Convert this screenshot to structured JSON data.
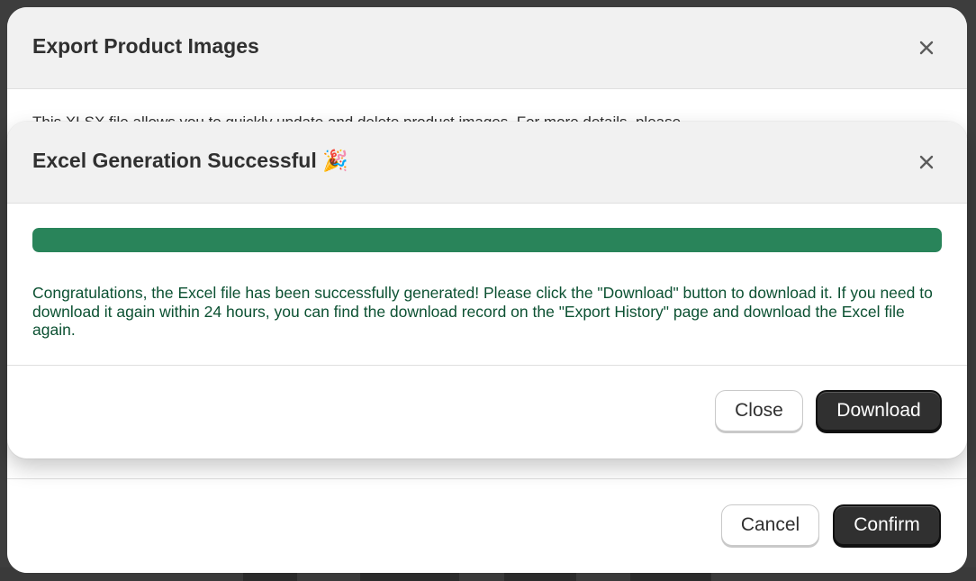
{
  "outer_dialog": {
    "title": "Export Product Images",
    "body_text": "This XLSX file allows you to quickly update and delete product images. For more details, please",
    "cancel_label": "Cancel",
    "confirm_label": "Confirm"
  },
  "inner_dialog": {
    "title": "Excel Generation Successful 🎉",
    "progress": 1.0,
    "message": "Congratulations, the Excel file has been successfully generated! Please click the \"Download\" button to download it. If you need to download it again within 24 hours, you can find the download record on the \"Export History\" page and download the Excel file again.",
    "close_label": "Close",
    "download_label": "Download"
  },
  "icons": {
    "close": "close-icon"
  },
  "colors": {
    "success_green": "#29845a",
    "success_text": "#0c5132",
    "primary_button": "#303030"
  }
}
